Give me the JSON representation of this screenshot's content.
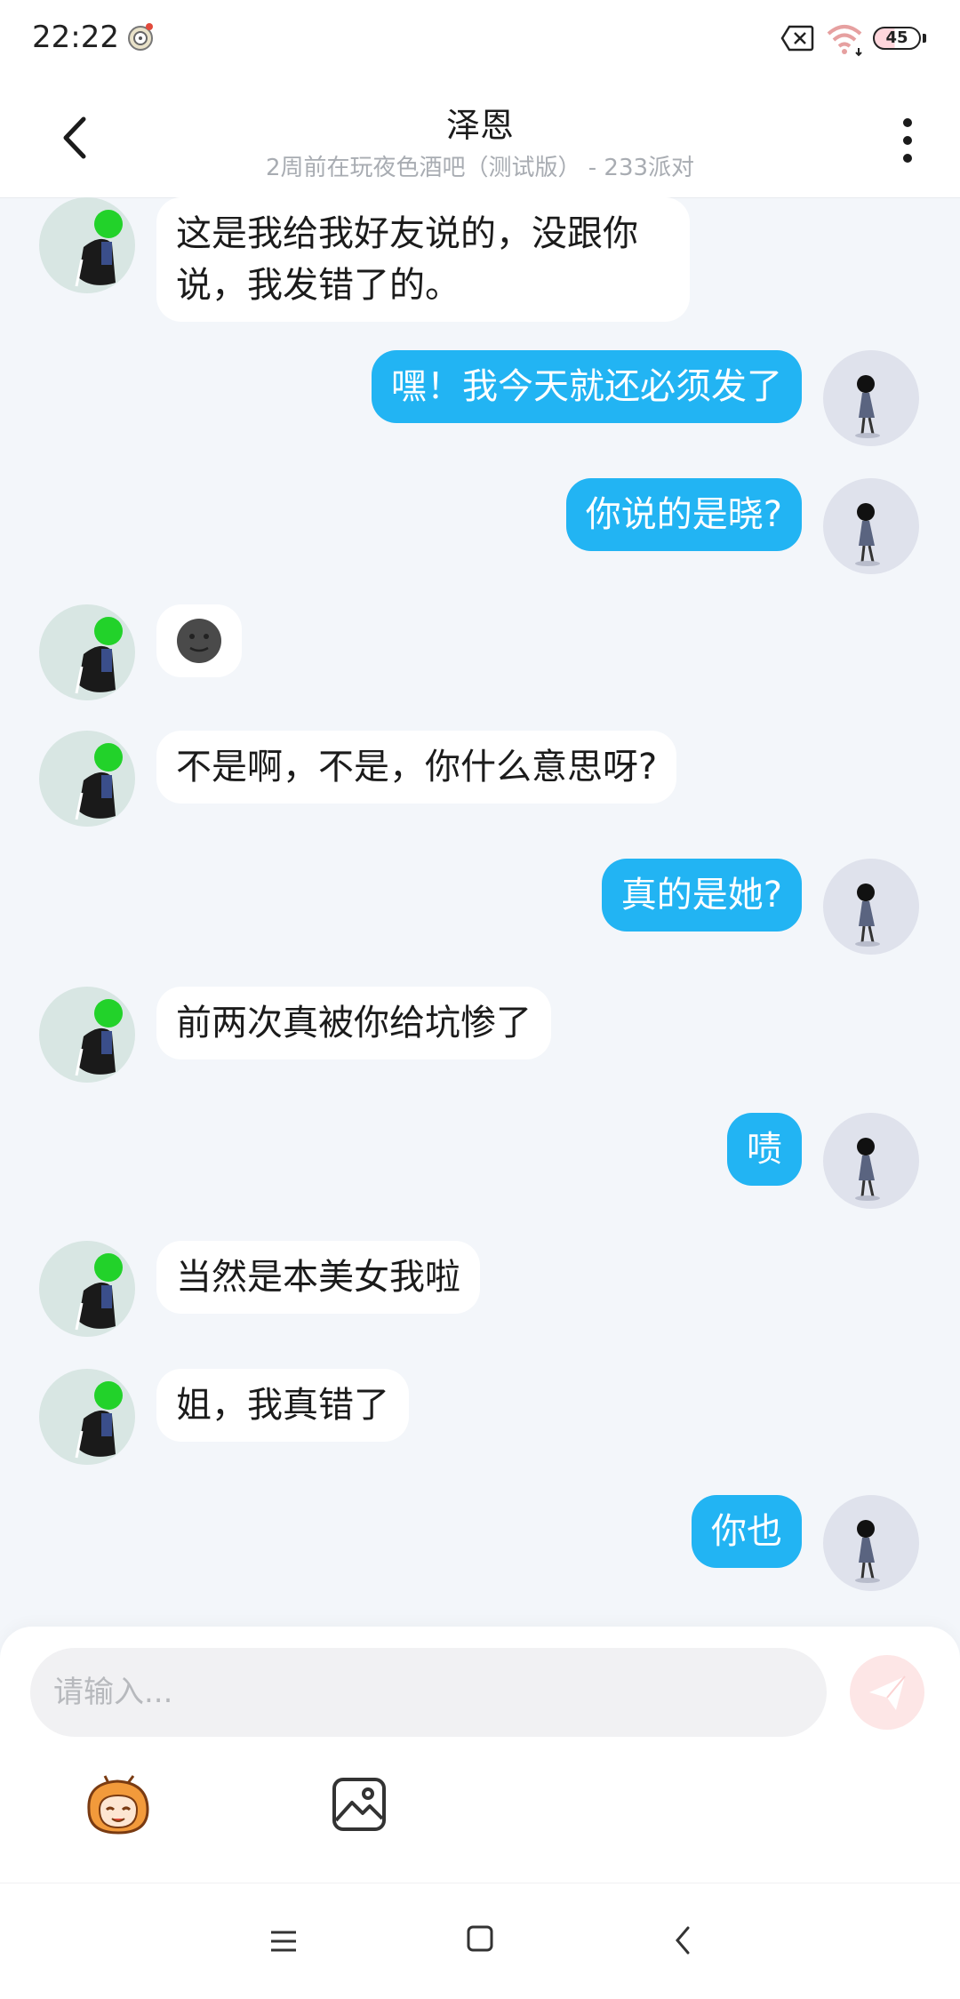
{
  "status_bar": {
    "time": "22:22",
    "battery": "45",
    "icons": [
      "alarm-app-icon",
      "no-sim-icon",
      "wifi-icon",
      "battery-icon"
    ]
  },
  "header": {
    "title": "泽恩",
    "subtitle": "2周前在玩夜色酒吧（测试版） - 233派对",
    "back_icon": "chevron-left-icon",
    "more_icon": "more-vertical-icon"
  },
  "messages": [
    {
      "from": "friend",
      "text": "这是我给我好友说的，没跟你说，我发错了的。"
    },
    {
      "from": "me",
      "text": "嘿！我今天就还必须发了"
    },
    {
      "from": "me",
      "text": "你说的是晓?"
    },
    {
      "from": "friend",
      "text": "🌚",
      "kind": "emoji"
    },
    {
      "from": "friend",
      "text": "不是啊，不是，你什么意思呀?"
    },
    {
      "from": "me",
      "text": "真的是她?"
    },
    {
      "from": "friend",
      "text": "前两次真被你给坑惨了"
    },
    {
      "from": "me",
      "text": "啧"
    },
    {
      "from": "friend",
      "text": "当然是本美女我啦"
    },
    {
      "from": "friend",
      "text": "姐，我真错了"
    },
    {
      "from": "me",
      "text": "你也"
    }
  ],
  "composer": {
    "placeholder": "请输入...",
    "value": "",
    "send_icon": "paper-plane-icon",
    "toolbar_icons": [
      "emoji-sticker-icon",
      "image-icon"
    ]
  },
  "colors": {
    "outgoing_bubble": "#22b4f3",
    "incoming_bubble": "#ffffff",
    "chat_background": "#f3f6fa",
    "send_button_disabled": "#fde6e6"
  },
  "nav_bar": {
    "icons": [
      "menu-icon",
      "home-icon",
      "back-icon"
    ]
  }
}
